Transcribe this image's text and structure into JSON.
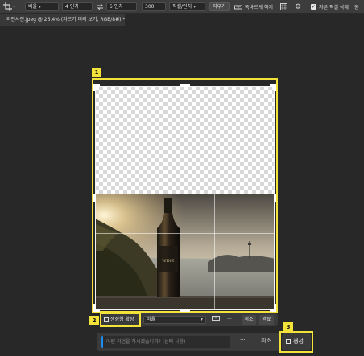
{
  "options_bar": {
    "ratio_select": "비율",
    "width_value": "4 인치",
    "height_value": "5 인치",
    "resolution_value": "300",
    "resolution_unit": "픽셀/인치",
    "clear_button": "지우기",
    "straighten_label": "똑바르게 하기",
    "delete_cropped_label": "자른 픽셀 삭제",
    "extra_label": "동"
  },
  "document_tab": {
    "title": "와인사진.jpeg @ 26.4% (자르기 미리 보기, RGB/8#) *"
  },
  "markers": {
    "m1": "1",
    "m2": "2",
    "m3": "3"
  },
  "task_bar": {
    "generative_expand_label": "생성형 확장",
    "ratio_select": "비율",
    "more": "···",
    "cancel": "취소",
    "done": "완료"
  },
  "prompt_bar": {
    "placeholder": "어떤 작업을 하시겠습니까? (선택 사항)",
    "more": "···",
    "cancel": "취소",
    "generate": "생성"
  },
  "photo": {
    "bottle_label": "WINE"
  },
  "colors": {
    "highlight": "#f2e23a",
    "background": "#282828",
    "toolbar": "#3c3c3c"
  }
}
